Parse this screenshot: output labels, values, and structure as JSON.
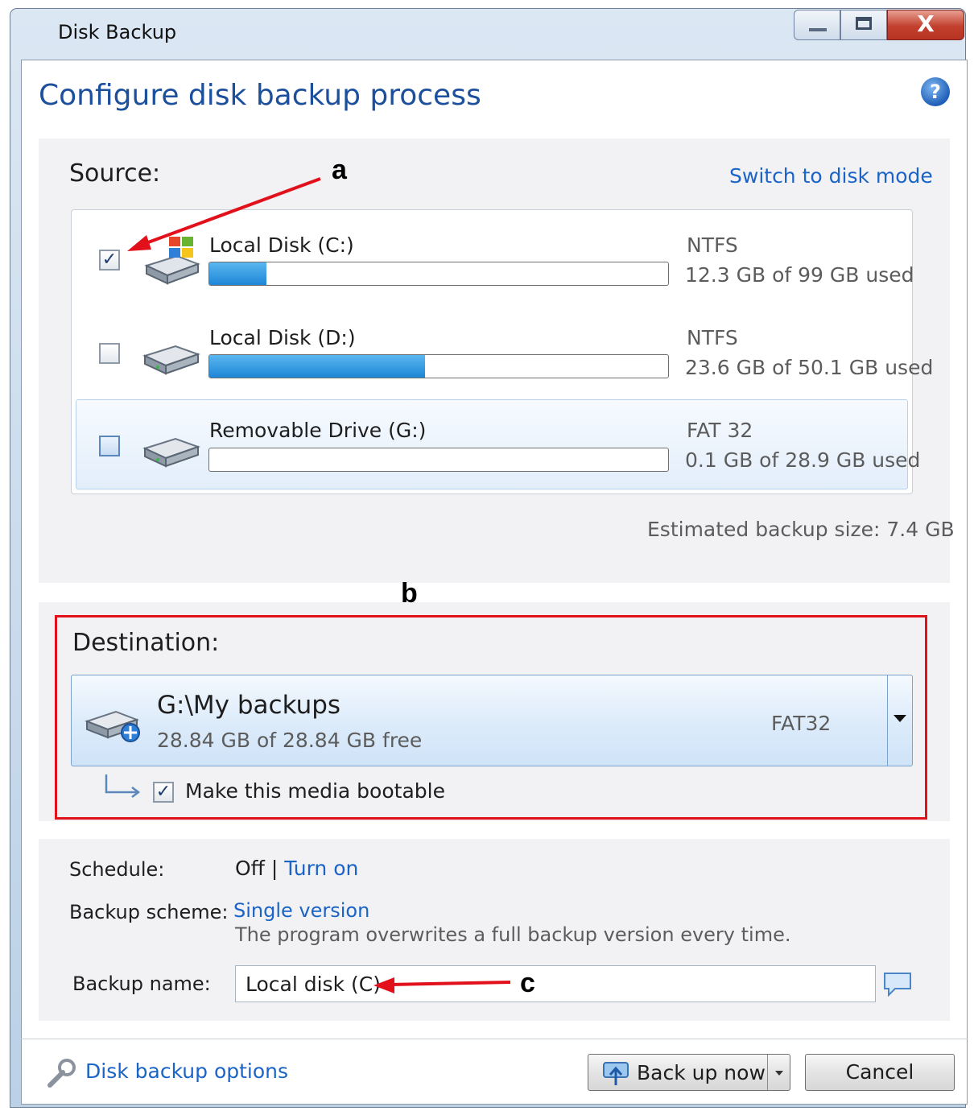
{
  "window": {
    "title": "Disk Backup",
    "minimize_icon": "minimize-icon",
    "maximize_icon": "maximize-icon",
    "close_glyph": "X"
  },
  "page_title": "Configure disk backup process",
  "help_glyph": "?",
  "source": {
    "label": "Source:",
    "switch_link": "Switch to disk mode",
    "disks": [
      {
        "name": "Local Disk (C:)",
        "fs": "NTFS",
        "usage": "12.3 GB of 99 GB used",
        "checked": true,
        "fill_fraction": 0.124
      },
      {
        "name": "Local Disk (D:)",
        "fs": "NTFS",
        "usage": "23.6 GB of 50.1 GB used",
        "checked": false,
        "fill_fraction": 0.471
      },
      {
        "name": "Removable Drive (G:)",
        "fs": "FAT 32",
        "usage": "0.1 GB of 28.9 GB used",
        "checked": false,
        "fill_fraction": 0.0
      }
    ],
    "estimated_size": "Estimated backup size: 7.4 GB"
  },
  "destination": {
    "label": "Destination:",
    "path": "G:\\My backups",
    "free": "28.84 GB of 28.84 GB free",
    "fs": "FAT32",
    "bootable_label": "Make this media bootable",
    "bootable_checked": true
  },
  "options": {
    "schedule_label": "Schedule:",
    "schedule_value": "Off",
    "schedule_sep": "|",
    "schedule_link": "Turn on",
    "scheme_label": "Backup scheme:",
    "scheme_link": "Single version",
    "scheme_desc": "The program overwrites a full backup version every time.",
    "name_label": "Backup name:",
    "name_value": "Local disk (C)"
  },
  "footer": {
    "options_link": "Disk backup options",
    "backup_now": "Back up now",
    "cancel": "Cancel"
  },
  "annotations": {
    "a": "a",
    "b": "b",
    "c": "c"
  },
  "colors": {
    "accent_link": "#1a63c7",
    "title_blue": "#1c4f9c",
    "highlight_red": "#e2101a",
    "bar_blue": "#1d86d6"
  }
}
